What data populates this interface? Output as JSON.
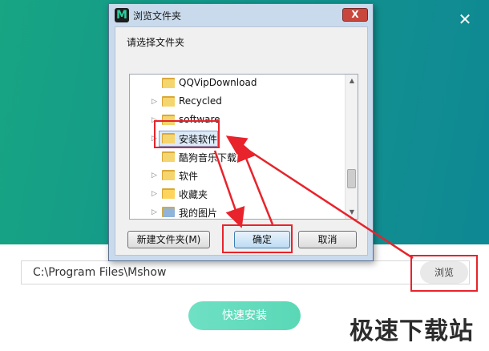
{
  "installer": {
    "close_icon": "close-icon",
    "install_path": "C:\\Program Files\\Mshow",
    "browse_label": "浏览",
    "install_label": "快速安装",
    "watermark": "极速下载站",
    "colors": {
      "background": "#14968c",
      "install_button": "#59d8b6",
      "highlight": "#e8232b"
    }
  },
  "dialog": {
    "app_icon_letter": "M",
    "title": "浏览文件夹",
    "close_symbol": "X",
    "prompt": "请选择文件夹",
    "tree_items": [
      {
        "label": "QQVipDownload",
        "expandable": false,
        "icon": "folder-icon"
      },
      {
        "label": "Recycled",
        "expandable": true,
        "icon": "folder-icon"
      },
      {
        "label": "software",
        "expandable": true,
        "icon": "folder-icon"
      },
      {
        "label": "安装软件",
        "expandable": true,
        "icon": "folder-icon",
        "selected": true
      },
      {
        "label": "酷狗音乐下载",
        "expandable": false,
        "icon": "folder-icon"
      },
      {
        "label": "软件",
        "expandable": true,
        "icon": "folder-icon"
      },
      {
        "label": "收藏夹",
        "expandable": true,
        "icon": "favorites-folder-icon"
      },
      {
        "label": "我的图片",
        "expandable": true,
        "icon": "pictures-folder-icon"
      }
    ],
    "buttons": {
      "new_folder": "新建文件夹(M)",
      "ok": "确定",
      "cancel": "取消"
    }
  }
}
